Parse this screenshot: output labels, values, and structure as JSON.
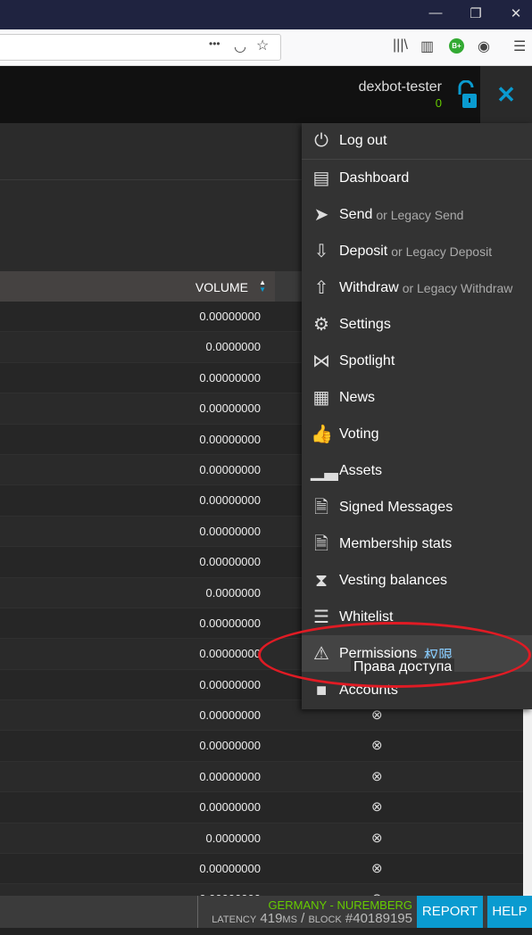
{
  "window": {
    "minimize_icon": "minimize-icon",
    "restore_icon": "restore-icon",
    "close_icon": "close-icon"
  },
  "browser": {
    "more_label": "•••",
    "extension_badge": "B+"
  },
  "header": {
    "username": "dexbot-tester",
    "balance": "0",
    "lock_state": "unlocked",
    "accent": "#0a9bd0"
  },
  "table": {
    "volume_header": "VOLUME",
    "volumes": [
      "0.00000000",
      "0.0000000",
      "0.00000000",
      "0.00000000",
      "0.00000000",
      "0.00000000",
      "0.00000000",
      "0.00000000",
      "0.00000000",
      "0.0000000",
      "0.00000000",
      "0.00000000",
      "0.00000000",
      "0.00000000",
      "0.00000000",
      "0.00000000",
      "0.00000000",
      "0.0000000",
      "0.00000000",
      "0.00000000"
    ]
  },
  "menu": {
    "items": [
      {
        "label": "Log out",
        "icon": "power-icon"
      },
      {
        "label": "Dashboard",
        "icon": "dashboard-icon"
      },
      {
        "label": "Send",
        "alt": "or Legacy Send",
        "icon": "send-icon"
      },
      {
        "label": "Deposit",
        "alt": "or Legacy Deposit",
        "icon": "deposit-icon"
      },
      {
        "label": "Withdraw",
        "alt": "or Legacy Withdraw",
        "icon": "withdraw-icon"
      },
      {
        "label": "Settings",
        "icon": "gears-icon"
      },
      {
        "label": "Spotlight",
        "icon": "spotlight-icon"
      },
      {
        "label": "News",
        "icon": "news-icon"
      },
      {
        "label": "Voting",
        "icon": "thumbs-up-icon"
      },
      {
        "label": "Assets",
        "icon": "assets-icon"
      },
      {
        "label": "Signed Messages",
        "icon": "document-icon"
      },
      {
        "label": "Membership stats",
        "icon": "document-icon"
      },
      {
        "label": "Vesting balances",
        "icon": "hourglass-icon"
      },
      {
        "label": "Whitelist",
        "icon": "list-icon"
      },
      {
        "label": "Permissions",
        "zh": "权限",
        "icon": "warning-icon"
      },
      {
        "label": "Accounts",
        "icon": "folder-icon"
      }
    ],
    "tooltip": "Права доступа"
  },
  "footer": {
    "location": "GERMANY - NUREMBERG",
    "latency_label": "LATENCY",
    "latency": "419",
    "latency_unit": "MS",
    "block_label": "BLOCK",
    "block": "#40189195",
    "report": "REPORT",
    "help": "HELP",
    "status_color": "#66cc00"
  }
}
